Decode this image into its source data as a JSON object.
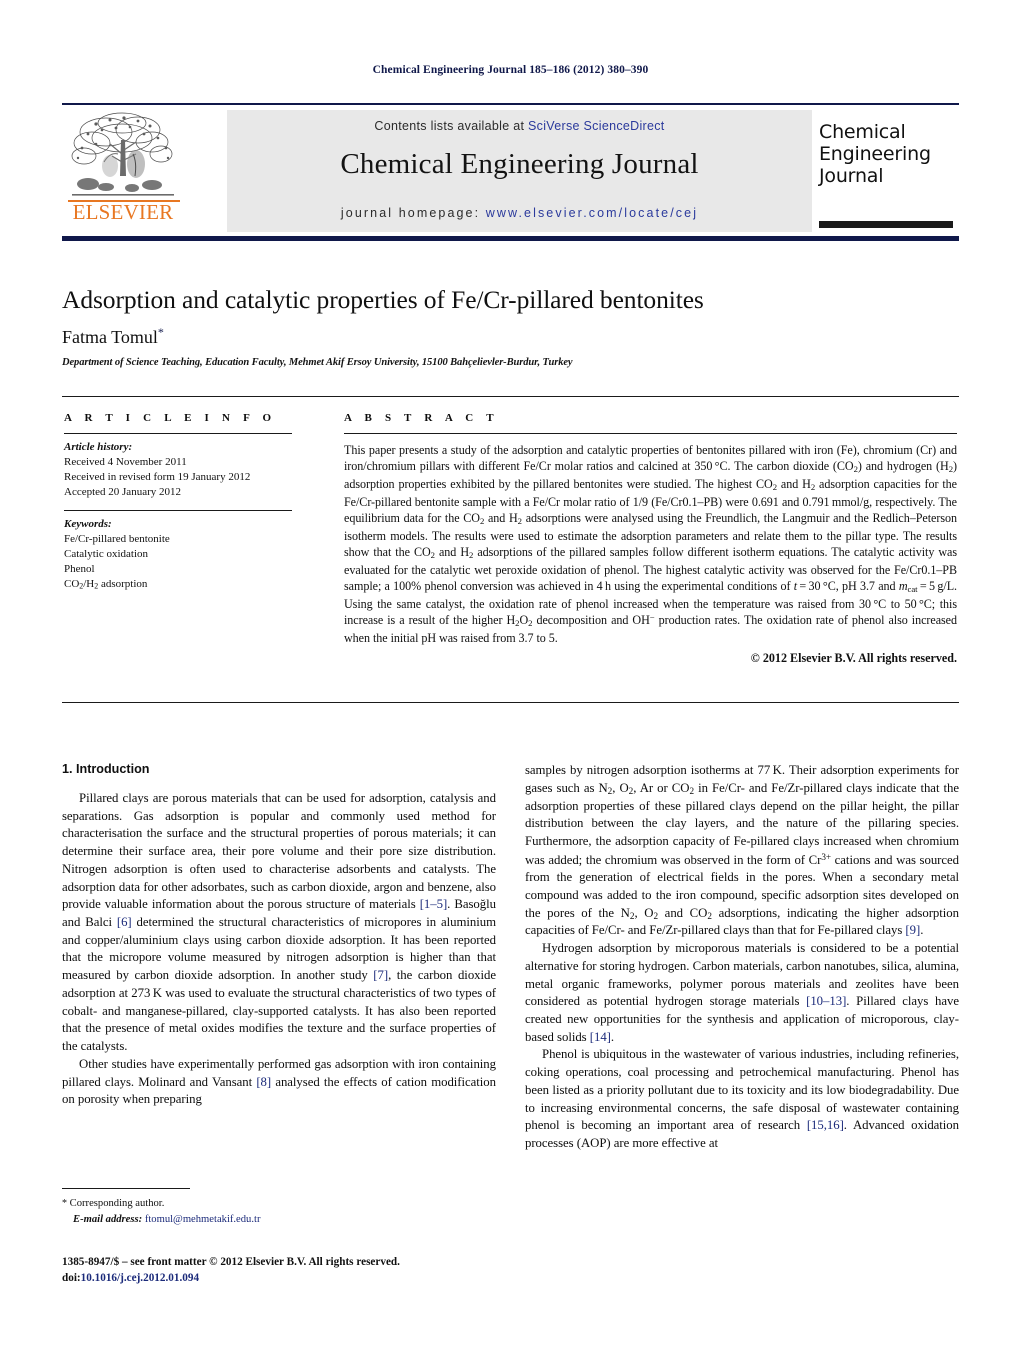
{
  "running_head": "Chemical Engineering Journal 185–186 (2012) 380–390",
  "masthead": {
    "contents_prefix": "Contents lists available at ",
    "contents_link": "SciVerse ScienceDirect",
    "journal_title": "Chemical Engineering Journal",
    "homepage_prefix": "journal homepage: ",
    "homepage_url": "www.elsevier.com/locate/cej",
    "publisher_wordmark": "ELSEVIER",
    "cover_title": "Chemical Engineering Journal",
    "link_color": "#2b3a9c",
    "elsevier_orange": "#e87722",
    "navy": "#10184a"
  },
  "article": {
    "title": "Adsorption and catalytic properties of Fe/Cr-pillared bentonites",
    "author": "Fatma Tomul",
    "author_marker": "*",
    "affiliation": "Department of Science Teaching, Education Faculty, Mehmet Akif Ersoy University, 15100 Bahçelievler-Burdur, Turkey"
  },
  "article_info": {
    "heading": "A R T I C L E   I N F O",
    "history_label": "Article history:",
    "history": [
      "Received 4 November 2011",
      "Received in revised form 19 January 2012",
      "Accepted 20 January 2012"
    ],
    "keywords_label": "Keywords:",
    "keywords": [
      "Fe/Cr-pillared bentonite",
      "Catalytic oxidation",
      "Phenol",
      "CO2/H2 adsorption"
    ]
  },
  "abstract": {
    "heading": "A B S T R A C T",
    "text": "This paper presents a study of the adsorption and catalytic properties of bentonites pillared with iron (Fe), chromium (Cr) and iron/chromium pillars with different Fe/Cr molar ratios and calcined at 350 °C. The carbon dioxide (CO2) and hydrogen (H2) adsorption properties exhibited by the pillared bentonites were studied. The highest CO2 and H2 adsorption capacities for the Fe/Cr-pillared bentonite sample with a Fe/Cr molar ratio of 1/9 (Fe/Cr0.1–PB) were 0.691 and 0.791 mmol/g, respectively. The equilibrium data for the CO2 and H2 adsorptions were analysed using the Freundlich, the Langmuir and the Redlich–Peterson isotherm models. The results were used to estimate the adsorption parameters and relate them to the pillar type. The results show that the CO2 and H2 adsorptions of the pillared samples follow different isotherm equations. The catalytic activity was evaluated for the catalytic wet peroxide oxidation of phenol. The highest catalytic activity was observed for the Fe/Cr0.1–PB sample; a 100% phenol conversion was achieved in 4 h using the experimental conditions of t = 30 °C, pH 3.7 and mcat = 5 g/L. Using the same catalyst, the oxidation rate of phenol increased when the temperature was raised from 30 °C to 50 °C; this increase is a result of the higher H2O2 decomposition and OH− production rates. The oxidation rate of phenol also increased when the initial pH was raised from 3.7 to 5.",
    "copyright": "© 2012 Elsevier B.V. All rights reserved."
  },
  "body": {
    "section_heading": "1.  Introduction",
    "left_paragraphs": [
      "Pillared clays are porous materials that can be used for adsorption, catalysis and separations. Gas adsorption is popular and commonly used method for characterisation the surface and the structural properties of porous materials; it can determine their surface area, their pore volume and their pore size distribution. Nitrogen adsorption is often used to characterise adsorbents and catalysts. The adsorption data for other adsorbates, such as carbon dioxide, argon and benzene, also provide valuable information about the porous structure of materials [1–5]. Basoğlu and Balci [6] determined the structural characteristics of micropores in aluminium and copper/aluminium clays using carbon dioxide adsorption. It has been reported that the micropore volume measured by nitrogen adsorption is higher than that measured by carbon dioxide adsorption. In another study [7], the carbon dioxide adsorption at 273 K was used to evaluate the structural characteristics of two types of cobalt- and manganese-pillared, clay-supported catalysts. It has also been reported that the presence of metal oxides modifies the texture and the surface properties of the catalysts.",
      "Other studies have experimentally performed gas adsorption with iron containing pillared clays. Molinard and Vansant [8] analysed the effects of cation modification on porosity when preparing"
    ],
    "right_paragraphs": [
      "samples by nitrogen adsorption isotherms at 77 K. Their adsorption experiments for gases such as N2, O2, Ar or CO2 in Fe/Cr- and Fe/Zr-pillared clays indicate that the adsorption properties of these pillared clays depend on the pillar height, the pillar distribution between the clay layers, and the nature of the pillaring species. Furthermore, the adsorption capacity of Fe-pillared clays increased when chromium was added; the chromium was observed in the form of Cr3+ cations and was sourced from the generation of electrical fields in the pores. When a secondary metal compound was added to the iron compound, specific adsorption sites developed on the pores of the N2, O2 and CO2 adsorptions, indicating the higher adsorption capacities of Fe/Cr- and Fe/Zr-pillared clays than that for Fe-pillared clays [9].",
      "Hydrogen adsorption by microporous materials is considered to be a potential alternative for storing hydrogen. Carbon materials, carbon nanotubes, silica, alumina, metal organic frameworks, polymer porous materials and zeolites have been considered as potential hydrogen storage materials [10–13]. Pillared clays have created new opportunities for the synthesis and application of microporous, clay-based solids [14].",
      "Phenol is ubiquitous in the wastewater of various industries, including refineries, coking operations, coal processing and petrochemical manufacturing. Phenol has been listed as a priority pollutant due to its toxicity and its low biodegradability. Due to increasing environmental concerns, the safe disposal of wastewater containing phenol is becoming an important area of research [15,16]. Advanced oxidation processes (AOP) are more effective at"
    ]
  },
  "footnotes": {
    "corresponding_marker": "*",
    "corresponding_text": "Corresponding author.",
    "email_label": "E-mail address:",
    "email": "ftomul@mehmetakif.edu.tr",
    "imprint_line": "1385-8947/$ – see front matter © 2012 Elsevier B.V. All rights reserved.",
    "doi_label": "doi:",
    "doi_value": "10.1016/j.cej.2012.01.094"
  }
}
